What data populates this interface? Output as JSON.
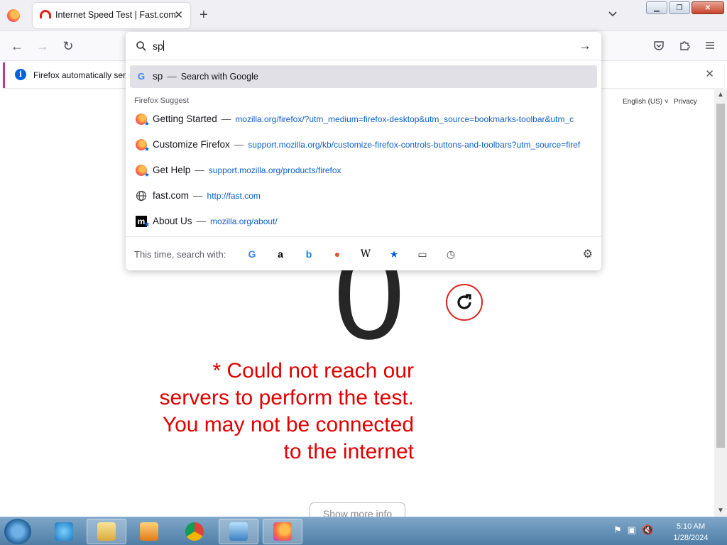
{
  "browser": {
    "tab_title": "Internet Speed Test | Fast.com"
  },
  "notification": {
    "text": "Firefox automatically sen"
  },
  "page": {
    "language": "English (US) ˅",
    "privacy": "Privacy",
    "speed_value": "0",
    "error_message": "* Could not reach our servers to perform the test. You may not be connected to the internet",
    "more_info": "Show more info"
  },
  "urlbar": {
    "input": "sp",
    "top_result": {
      "query": "sp",
      "action": "Search with Google"
    },
    "section_label": "Firefox Suggest",
    "suggestions": [
      {
        "title": "Getting Started",
        "url": "mozilla.org/firefox/?utm_medium=firefox-desktop&utm_source=bookmarks-toolbar&utm_c",
        "icon": "firefox-bookmark-icon"
      },
      {
        "title": "Customize Firefox",
        "url": "support.mozilla.org/kb/customize-firefox-controls-buttons-and-toolbars?utm_source=firef",
        "icon": "firefox-bookmark-icon"
      },
      {
        "title": "Get Help",
        "url": "support.mozilla.org/products/firefox",
        "icon": "firefox-bookmark-icon"
      },
      {
        "title": "fast.com",
        "url": "http://fast.com",
        "icon": "globe-icon"
      },
      {
        "title": "About Us",
        "url": "mozilla.org/about/",
        "icon": "mozilla-bookmark-icon"
      }
    ],
    "oneoff_label": "This time, search with:",
    "engines": [
      "google",
      "amazon",
      "bing",
      "duckduckgo",
      "wikipedia",
      "bookmarks",
      "tabs",
      "history"
    ]
  },
  "taskbar": {
    "time": "5:10 AM",
    "date": "1/28/2024"
  },
  "colors": {
    "error_red": "#e00000",
    "link_blue": "#0c60cb",
    "highlight": "#e0e0e6"
  }
}
